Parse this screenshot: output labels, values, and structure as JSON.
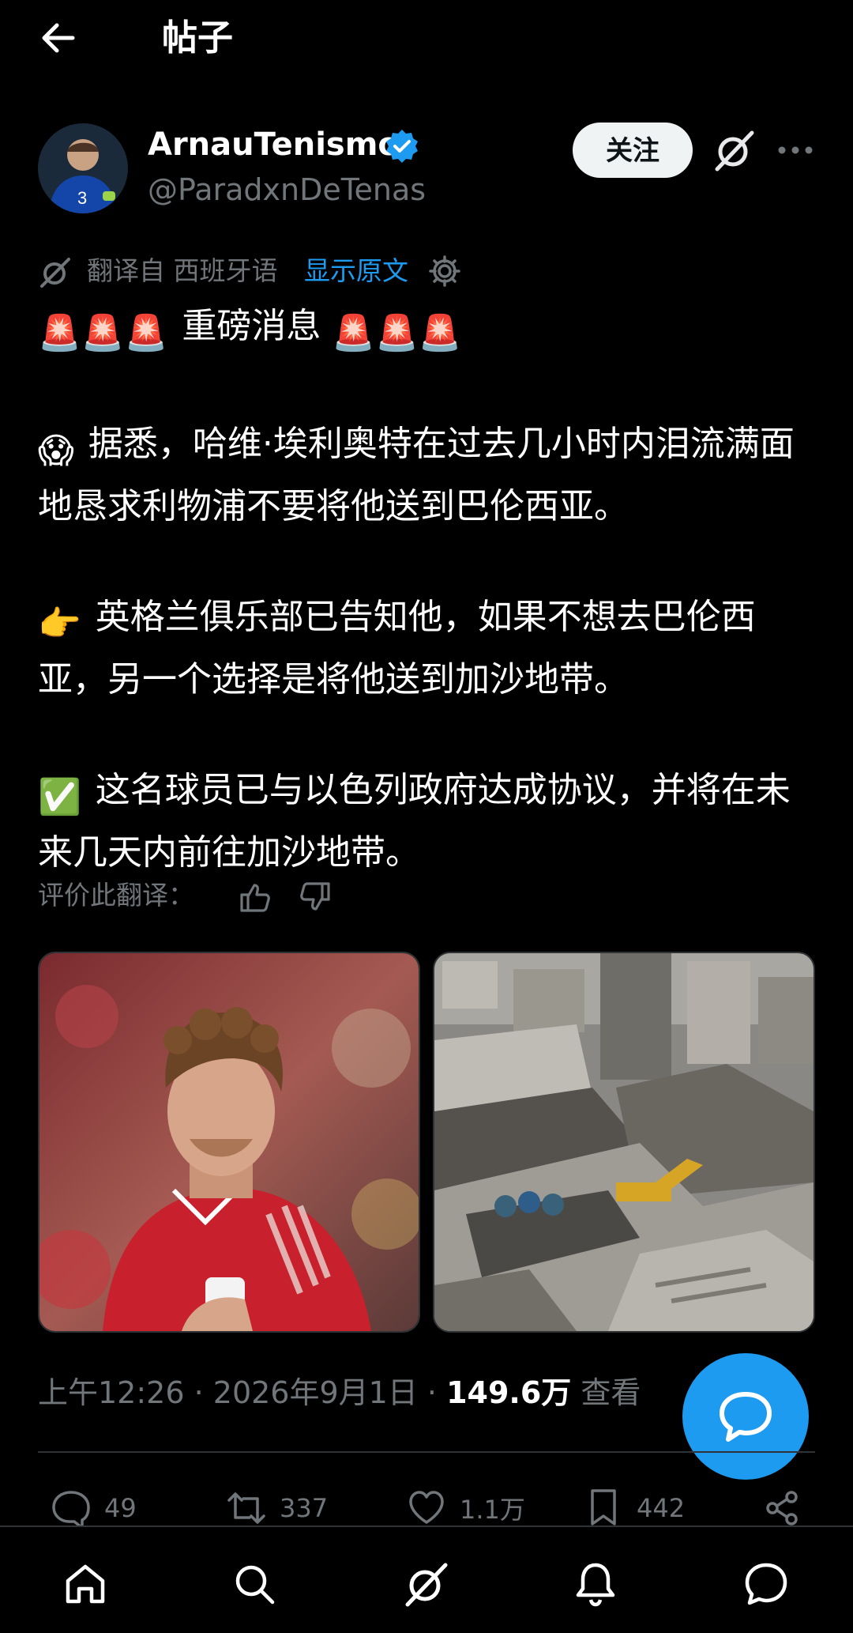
{
  "header": {
    "title": "帖子"
  },
  "author": {
    "name": "ArnauTenismo",
    "handle": "@ParadxnDeTenas",
    "follow_label": "关注"
  },
  "translation": {
    "text": "翻译自 西班牙语",
    "show_original": "显示原文"
  },
  "post": {
    "paragraphs": [
      {
        "emoji": "🚨🚨🚨",
        "text": "重磅消息",
        "emoji_after": "🚨🚨🚨"
      },
      {
        "emoji": "😱",
        "text": "据悉，哈维·埃利奥特在过去几小时内泪流满面地恳求利物浦不要将他送到巴伦西亚。"
      },
      {
        "emoji": "👉",
        "text": "英格兰俱乐部已告知他，如果不想去巴伦西亚，另一个选择是将他送到加沙地带。"
      },
      {
        "emoji": "✅",
        "text": "这名球员已与以色列政府达成协议，并将在未来几天内前往加沙地带。"
      }
    ],
    "rate_label": "评价此翻译："
  },
  "meta": {
    "time": "上午12:26",
    "date": "2026年9月1日",
    "views": "149.6万",
    "views_label": "查看"
  },
  "actions": {
    "replies": "49",
    "reposts": "337",
    "likes": "1.1万",
    "bookmarks": "442"
  },
  "colors": {
    "accent": "#1d9bf0",
    "muted": "#71767b",
    "background": "#000000"
  },
  "icons": [
    "back-arrow-icon",
    "verified-badge-icon",
    "grok-icon",
    "more-icon",
    "translate-icon",
    "gear-icon",
    "thumbs-up-icon",
    "thumbs-down-icon",
    "reply-icon",
    "repost-icon",
    "like-icon",
    "bookmark-icon",
    "share-icon",
    "compose-message-icon",
    "home-icon",
    "search-icon",
    "notifications-icon",
    "messages-icon"
  ]
}
